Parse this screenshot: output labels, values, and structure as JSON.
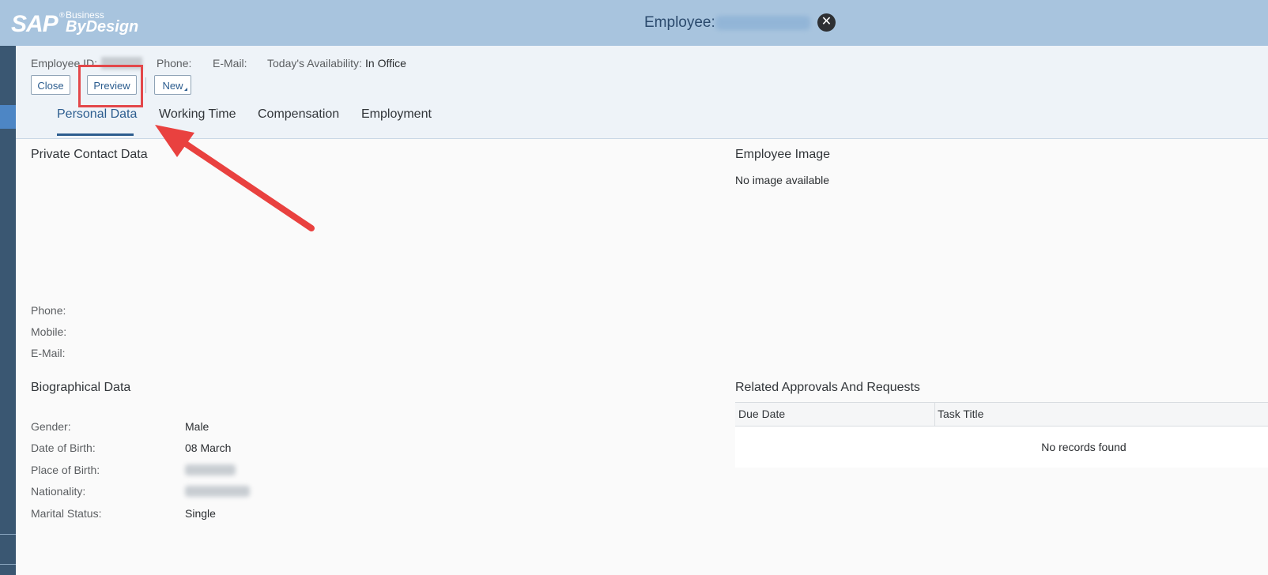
{
  "brand": {
    "logo_main": "SAP",
    "logo_reg": "®",
    "logo_business": "Business",
    "logo_bydesign": "ByDesign"
  },
  "titlebar": {
    "title": "Employee:",
    "close_glyph": "✕"
  },
  "header": {
    "employee_id_label": "Employee ID:",
    "phone_label": "Phone:",
    "email_label": "E-Mail:",
    "availability_label": "Today's Availability:",
    "availability_value": "In Office"
  },
  "toolbar": {
    "close_label": "Close",
    "preview_label": "Preview",
    "new_label": "New"
  },
  "tabs": [
    {
      "label": "Personal Data"
    },
    {
      "label": "Working Time"
    },
    {
      "label": "Compensation"
    },
    {
      "label": "Employment"
    }
  ],
  "private_contact": {
    "title": "Private Contact Data",
    "phone_label": "Phone:",
    "mobile_label": "Mobile:",
    "email_label": "E-Mail:"
  },
  "employee_image": {
    "title": "Employee Image",
    "empty_text": "No image available"
  },
  "biographical": {
    "title": "Biographical Data",
    "gender_label": "Gender:",
    "gender_value": "Male",
    "dob_label": "Date of Birth:",
    "dob_value": "08 March",
    "pob_label": "Place of Birth:",
    "nationality_label": "Nationality:",
    "marital_label": "Marital Status:",
    "marital_value": "Single"
  },
  "approvals": {
    "title": "Related Approvals And Requests",
    "columns": [
      "Due Date",
      "Task Title"
    ],
    "empty_text": "No records found"
  },
  "colors": {
    "shellbar": "#a8c4de",
    "accent": "#2c5d8f",
    "highlight": "#e3474a"
  }
}
